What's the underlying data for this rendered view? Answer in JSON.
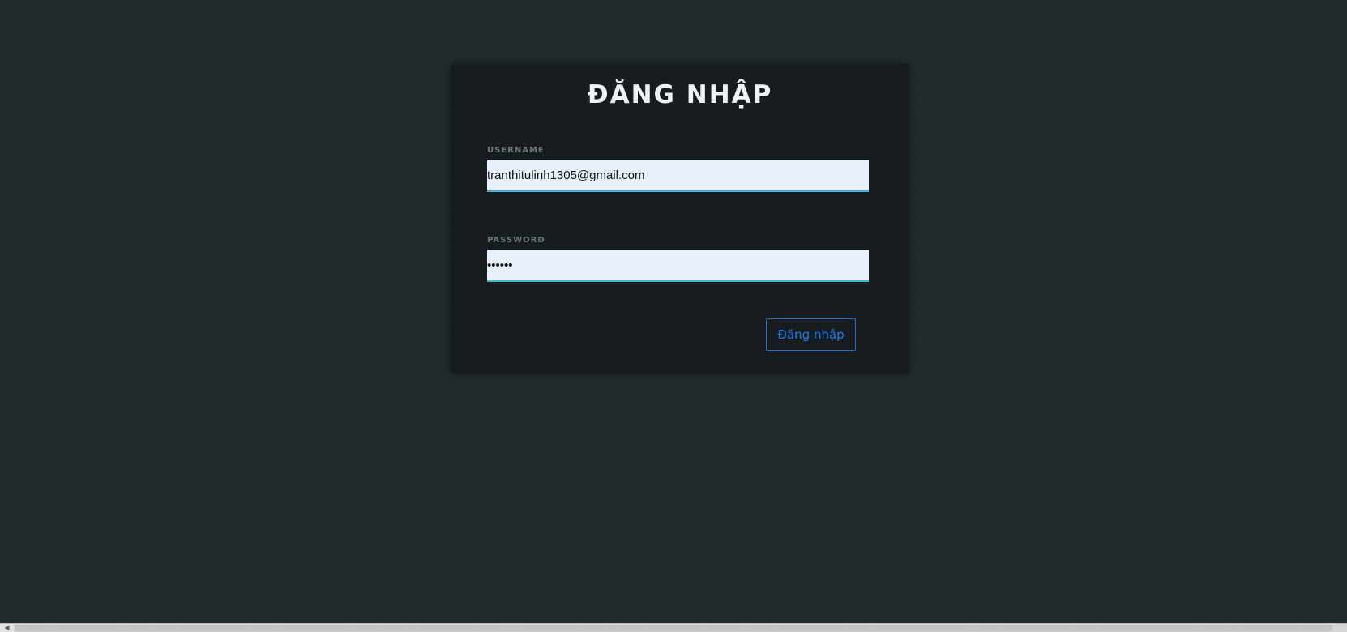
{
  "login": {
    "title": "ĐĂNG NHẬP",
    "username": {
      "label": "USERNAME",
      "value": "tranthitulinh1305@gmail.com"
    },
    "password": {
      "label": "PASSWORD",
      "value": "••••••"
    },
    "submit_label": "Đăng nhập"
  },
  "scrollbar": {
    "left_arrow_glyph": "◀"
  },
  "colors": {
    "background": "#222b2c",
    "card": "#161c1f",
    "input_background": "#e8f0fe",
    "input_underline": "#3fb5d6",
    "button_accent": "#1f7cf0",
    "label": "#6b767d",
    "title": "#eef2f4"
  }
}
